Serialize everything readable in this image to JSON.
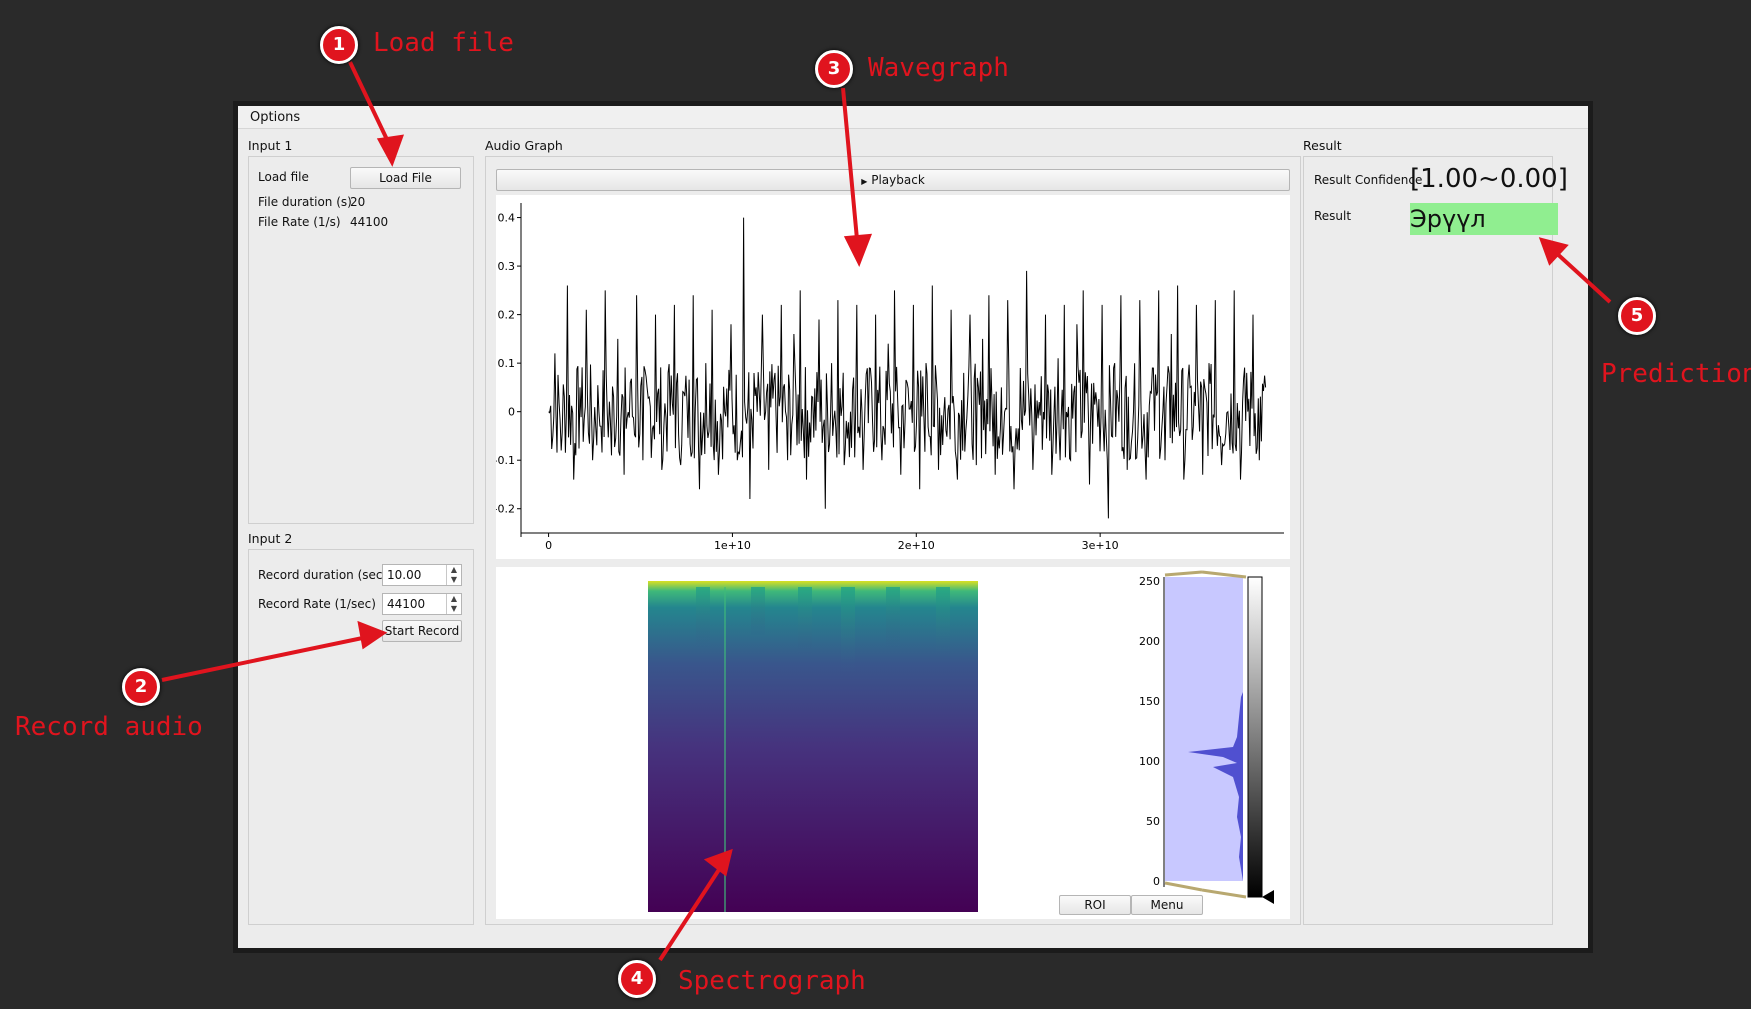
{
  "menu": {
    "options": "Options"
  },
  "input1": {
    "title": "Input 1",
    "load_file_label": "Load file",
    "load_file_button": "Load File",
    "duration_label": "File duration (s)",
    "duration_value": "20",
    "rate_label": "File Rate (1/s)",
    "rate_value": "44100"
  },
  "input2": {
    "title": "Input 2",
    "record_duration_label": "Record duration (sec)",
    "record_duration_value": "10.00",
    "record_rate_label": "Record Rate (1/sec)",
    "record_rate_value": "44100",
    "start_record_button": "Start Record"
  },
  "audio_graph": {
    "title": "Audio Graph",
    "playback_button": "Playback",
    "playback_icon": "triangle-right-icon"
  },
  "result": {
    "title": "Result",
    "confidence_label": "Result Confidence",
    "confidence_value": "[1.00~0.00]",
    "result_label": "Result",
    "result_value": "Эрүүл",
    "result_bg": "#90ee90"
  },
  "histogram": {
    "roi_button": "ROI",
    "menu_button": "Menu",
    "yticks": [
      "250",
      "200",
      "150",
      "100",
      "50",
      "0"
    ],
    "region_color": "#c8c8ff",
    "hist_color": "#5050d0"
  },
  "chart_data": [
    {
      "type": "line",
      "title": "",
      "xlabel": "",
      "ylabel": "",
      "xticks": [
        "0",
        "1e+10",
        "2e+10",
        "3e+10"
      ],
      "yticks": [
        "0.4",
        "0.3",
        "0.2",
        "0.1",
        "0",
        "-0.1",
        "-0.2"
      ],
      "ylim": [
        -0.25,
        0.43
      ],
      "xlim": [
        -1500000000.0,
        40000000000.0
      ],
      "series": [
        {
          "x_start": 0,
          "x_end": 39000000000.0,
          "values": [
            0.0,
            0.12,
            -0.08,
            0.26,
            -0.14,
            0.05,
            0.21,
            -0.1,
            0.0,
            0.25,
            -0.09,
            0.15,
            -0.13,
            0.06,
            0.24,
            -0.1,
            0.03,
            0.2,
            -0.12,
            0.08,
            0.22,
            -0.11,
            0.02,
            0.24,
            -0.16,
            0.1,
            0.21,
            -0.13,
            0.0,
            0.18,
            -0.1,
            0.4,
            -0.18,
            0.05,
            0.2,
            -0.12,
            0.08,
            0.22,
            -0.1,
            0.16,
            0.25,
            -0.14,
            0.03,
            0.19,
            -0.2,
            0.1,
            0.23,
            -0.11,
            0.0,
            0.22,
            -0.12,
            0.09,
            0.2,
            -0.1,
            0.14,
            0.25,
            -0.13,
            0.06,
            0.22,
            -0.16,
            0.1,
            0.26,
            -0.12,
            0.03,
            0.21,
            -0.14,
            0.08,
            0.2,
            -0.11,
            0.15,
            0.24,
            -0.13,
            0.05,
            0.23,
            -0.16,
            0.09,
            0.29,
            -0.12,
            0.02,
            0.2,
            -0.13,
            0.11,
            0.22,
            -0.1,
            0.18,
            0.25,
            -0.15,
            0.04,
            0.22,
            -0.22,
            0.1,
            0.24,
            -0.12,
            0.0,
            0.23,
            -0.14,
            0.09,
            0.25,
            -0.1,
            0.16,
            0.26,
            -0.14,
            0.05,
            0.22,
            -0.13,
            0.1,
            0.23,
            -0.11,
            0.0,
            0.25,
            -0.14,
            0.08,
            0.2,
            -0.1,
            0.05
          ]
        }
      ]
    },
    {
      "type": "heatmap",
      "title": "",
      "colormap": "viridis",
      "description_values": {
        "high_freq_row": "bright",
        "rest": "dark"
      }
    }
  ]
}
